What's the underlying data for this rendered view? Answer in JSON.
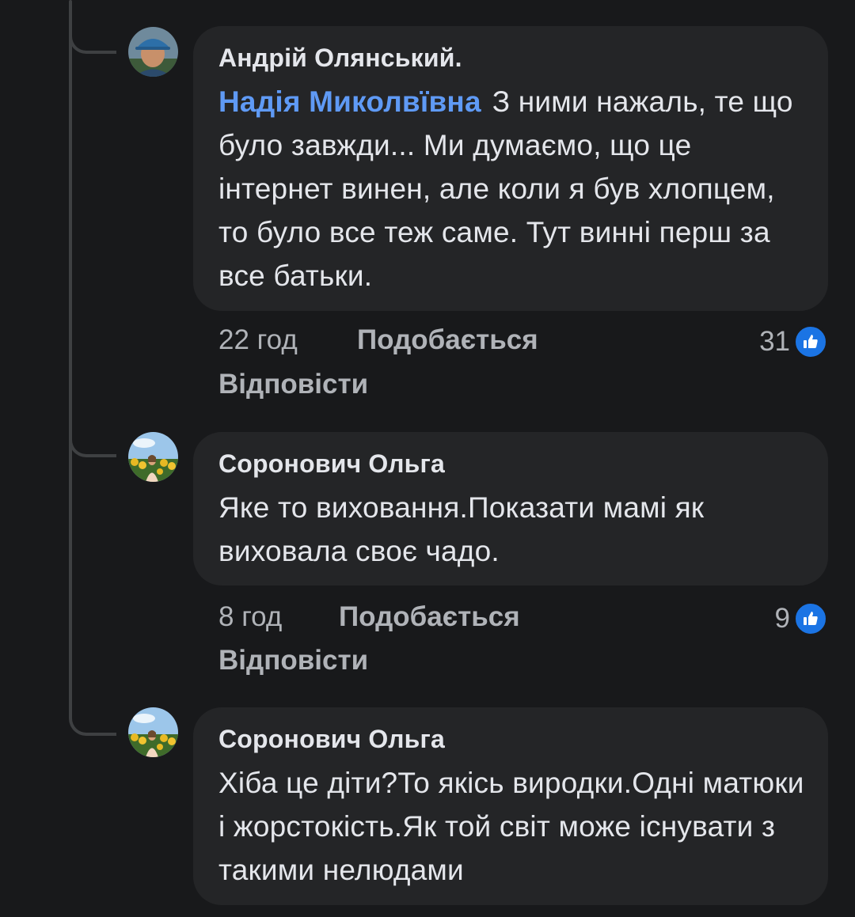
{
  "comments": [
    {
      "author": "Андрій Олянський.",
      "mention": "Надія Миколвївна",
      "text": "З ними нажаль, те що було завжди... Ми думаємо, що це інтернет винен, але коли я був хлопцем, то було все теж саме. Тут винні перш за все батьки.",
      "time": "22 год",
      "like_label": "Подобається",
      "reply_label": "Відповісти",
      "reaction_count": "31",
      "reaction_icon": "like-icon",
      "avatar_icon": "man-in-cap-avatar"
    },
    {
      "author": "Соронович Ольга",
      "text": "Яке то виховання.Показати мамі як виховала своє чадо.",
      "time": "8 год",
      "like_label": "Подобається",
      "reply_label": "Відповісти",
      "reaction_count": "9",
      "reaction_icon": "like-icon",
      "avatar_icon": "woman-sunflowers-avatar"
    },
    {
      "author": "Соронович Ольга",
      "text": "Хіба це діти?То якісь виродки.Одні матюки і жорстокість.Як той світ може існувати з такими нелюдами",
      "avatar_icon": "woman-sunflowers-avatar"
    }
  ],
  "colors": {
    "background": "#18191b",
    "bubble": "#242527",
    "text": "#e4e6eb",
    "secondary_text": "#b0b3b8",
    "mention": "#5f9af5",
    "like_blue": "#1b74e4",
    "thread_line": "#3e4042"
  }
}
